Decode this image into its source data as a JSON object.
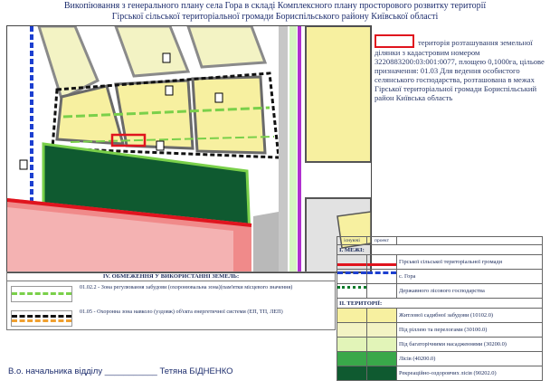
{
  "title": {
    "line1": "Викопіювання з генерального плану села  Гора  в складі Комплексного плану просторового розвитку території",
    "line2": "Гірської сільської територіальної громади Бориспільського району Київської області"
  },
  "legend_note": "територія розташування земельної ділянки з кадастровим номером 3220883200:03:001:0077, площею 0,1000га, цільове призначення: 01.03 Для ведення особистого селянського господарства, розташована в межах Гірської територіальної громади Бориспільський район Київська область",
  "table": {
    "col_existing": "існуючі",
    "col_project": "проект",
    "section1": "І. МЕЖІ:",
    "boundaries": [
      {
        "label": "Гірської сільської територіальної громади"
      },
      {
        "label": "с. Гора"
      },
      {
        "label": "Державного лісового господарства"
      }
    ],
    "section2": "ІІ. ТЕРИТОРІЇ:",
    "territories": [
      {
        "label": "Житлової садибної забудови (10102.0)",
        "color": "#f7f0a0"
      },
      {
        "label": "Під ріллею та перелогами (30100.0)",
        "color": "#f3f3c4"
      },
      {
        "label": "Під багаторічними насадженнями (30200.0)",
        "color": "#e2f4b8"
      },
      {
        "label": "Лісів (40200.0)",
        "color": "#39a84a"
      },
      {
        "label": "Рекреаційно-оздоровчих лісів (90202.0)",
        "color": "#0f5a30"
      }
    ]
  },
  "restrictions": {
    "header": "ІV. ОБМЕЖЕННЯ У ВИКОРИСТАННІ ЗЕМЕЛЬ:",
    "items": [
      {
        "label": "01.02.2 - Зона регулювання забудови (охоронювальна зона)(пам'ятки місцевого значення)"
      },
      {
        "label": "01.05 - Охоронна зона навколо (уздовж) об'єкта енергетичної системи (ЕП, ТП, ЛЕП)"
      }
    ]
  },
  "footer": {
    "signature": "В.о. начальника відділу ___________ Тетяна БІДНЕНКО"
  },
  "colors": {
    "plot_outline": "#e0141e",
    "forest_dark": "#0f5a30",
    "residential": "#f7f0a0",
    "road": "#9a9a9a",
    "boundary_blue": "#1c3fd0"
  }
}
